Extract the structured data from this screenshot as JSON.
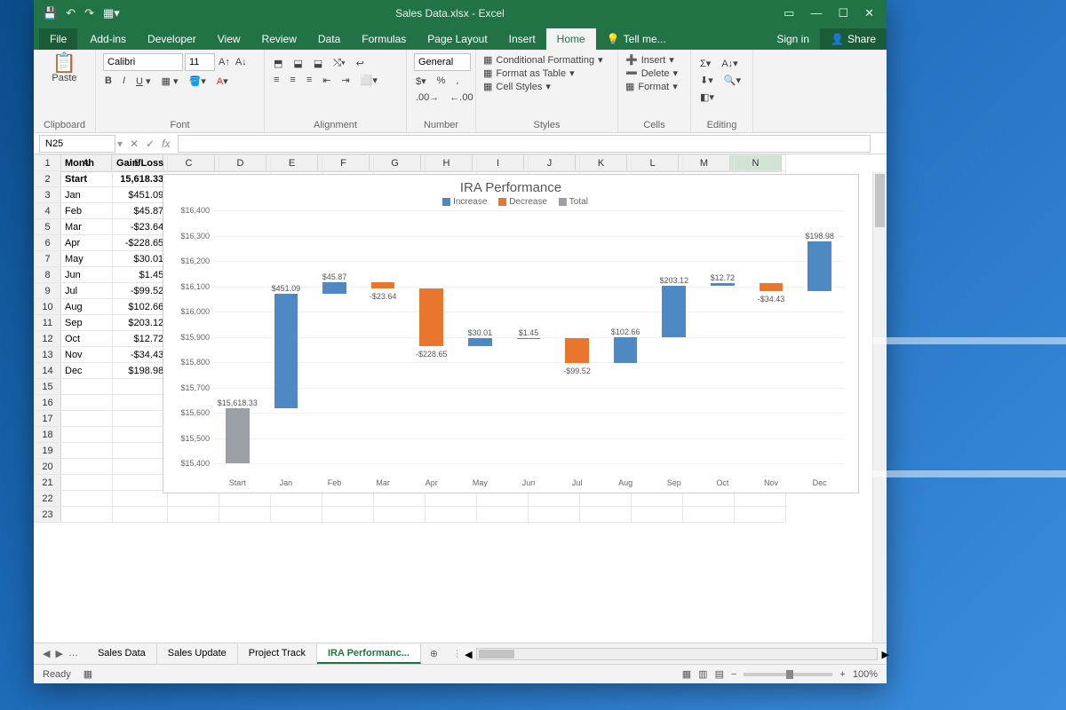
{
  "title": "Sales Data.xlsx - Excel",
  "tabs": {
    "file": "File",
    "list": [
      "Home",
      "Insert",
      "Page Layout",
      "Formulas",
      "Data",
      "Review",
      "View",
      "Developer",
      "Add-ins"
    ],
    "active": "Home",
    "tell": "Tell me...",
    "signin": "Sign in",
    "share": "Share"
  },
  "ribbon": {
    "clipboard": {
      "label": "Clipboard",
      "paste": "Paste"
    },
    "font": {
      "label": "Font",
      "name": "Calibri",
      "size": "11"
    },
    "alignment": {
      "label": "Alignment"
    },
    "number": {
      "label": "Number",
      "format": "General"
    },
    "styles": {
      "label": "Styles",
      "cf": "Conditional Formatting",
      "fat": "Format as Table",
      "cs": "Cell Styles"
    },
    "cells": {
      "label": "Cells",
      "insert": "Insert",
      "delete": "Delete",
      "format": "Format"
    },
    "editing": {
      "label": "Editing"
    }
  },
  "namebox": "N25",
  "columns": [
    "A",
    "B",
    "C",
    "D",
    "E",
    "F",
    "G",
    "H",
    "I",
    "J",
    "K",
    "L",
    "M",
    "N"
  ],
  "rows_data": {
    "header": [
      "Month",
      "Gain/Loss"
    ],
    "rows": [
      [
        "Start",
        "15,618.33"
      ],
      [
        "Jan",
        "$451.09"
      ],
      [
        "Feb",
        "$45.87"
      ],
      [
        "Mar",
        "-$23.64"
      ],
      [
        "Apr",
        "-$228.65"
      ],
      [
        "May",
        "$30.01"
      ],
      [
        "Jun",
        "$1.45"
      ],
      [
        "Jul",
        "-$99.52"
      ],
      [
        "Aug",
        "$102.66"
      ],
      [
        "Sep",
        "$203.12"
      ],
      [
        "Oct",
        "$12.72"
      ],
      [
        "Nov",
        "-$34.43"
      ],
      [
        "Dec",
        "$198.98"
      ]
    ]
  },
  "chart_data": {
    "type": "waterfall",
    "title": "IRA Performance",
    "legend": [
      "Increase",
      "Decrease",
      "Total"
    ],
    "ylabel": "",
    "ylim": [
      15400,
      16400
    ],
    "yticks": [
      15400,
      15500,
      15600,
      15700,
      15800,
      15900,
      16000,
      16100,
      16200,
      16300,
      16400
    ],
    "categories": [
      "Start",
      "Jan",
      "Feb",
      "Mar",
      "Apr",
      "May",
      "Jun",
      "Jul",
      "Aug",
      "Sep",
      "Oct",
      "Nov",
      "Dec"
    ],
    "series": [
      {
        "category": "Start",
        "value": 15618.33,
        "kind": "total",
        "label": "$15,618.33"
      },
      {
        "category": "Jan",
        "value": 451.09,
        "kind": "increase",
        "label": "$451.09"
      },
      {
        "category": "Feb",
        "value": 45.87,
        "kind": "increase",
        "label": "$45.87"
      },
      {
        "category": "Mar",
        "value": -23.64,
        "kind": "decrease",
        "label": "-$23.64"
      },
      {
        "category": "Apr",
        "value": -228.65,
        "kind": "decrease",
        "label": "-$228.65"
      },
      {
        "category": "May",
        "value": 30.01,
        "kind": "increase",
        "label": "$30.01"
      },
      {
        "category": "Jun",
        "value": 1.45,
        "kind": "increase",
        "label": "$1.45"
      },
      {
        "category": "Jul",
        "value": -99.52,
        "kind": "decrease",
        "label": "-$99.52"
      },
      {
        "category": "Aug",
        "value": 102.66,
        "kind": "increase",
        "label": "$102.66"
      },
      {
        "category": "Sep",
        "value": 203.12,
        "kind": "increase",
        "label": "$203.12"
      },
      {
        "category": "Oct",
        "value": 12.72,
        "kind": "increase",
        "label": "$12.72"
      },
      {
        "category": "Nov",
        "value": -34.43,
        "kind": "decrease",
        "label": "-$34.43"
      },
      {
        "category": "Dec",
        "value": 198.98,
        "kind": "increase",
        "label": "$198.98"
      }
    ]
  },
  "sheet_tabs": {
    "list": [
      "Sales Data",
      "Sales Update",
      "Project Track",
      "IRA Performanc..."
    ],
    "active": "IRA Performanc..."
  },
  "status": {
    "ready": "Ready",
    "zoom": "100%"
  }
}
